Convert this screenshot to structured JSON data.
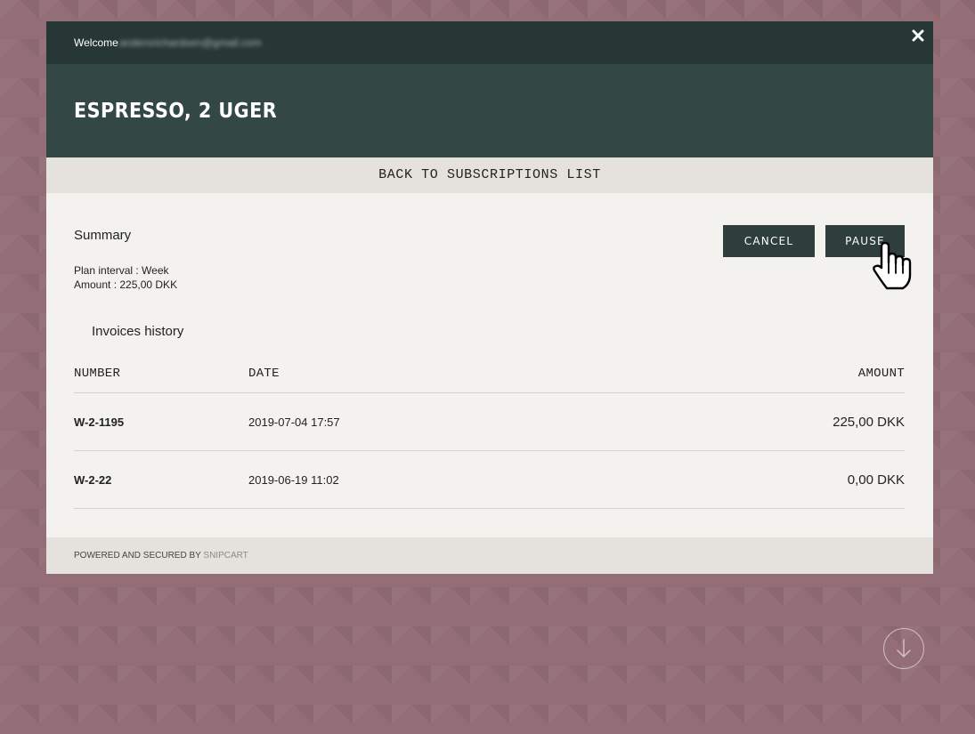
{
  "topbar": {
    "welcome_label": "Welcome",
    "user_email": "andersrichardsen@gmail.com"
  },
  "header": {
    "title": "ESPRESSO, 2 UGER"
  },
  "navigation": {
    "back_label": "BACK TO SUBSCRIPTIONS LIST"
  },
  "summary": {
    "heading": "Summary",
    "plan_interval": "Plan interval : Week",
    "amount": "Amount : 225,00 DKK"
  },
  "actions": {
    "cancel_label": "CANCEL",
    "pause_label": "PAUSE"
  },
  "invoices": {
    "heading": "Invoices history",
    "columns": [
      "NUMBER",
      "DATE",
      "AMOUNT"
    ],
    "rows": [
      {
        "number": "W-2-1195",
        "date": "2019-07-04 17:57",
        "amount": "225,00 DKK"
      },
      {
        "number": "W-2-22",
        "date": "2019-06-19 11:02",
        "amount": "0,00 DKK"
      }
    ]
  },
  "footer": {
    "text": "POWERED AND SECURED BY ",
    "link": "SNIPCART"
  },
  "icons": {
    "close": "close-icon",
    "cursor": "hand-pointer-icon",
    "scroll": "arrow-down-icon"
  },
  "colors": {
    "background": "#936e76",
    "topbar": "#273735",
    "titlebar": "#334745",
    "button": "#2d3e3c",
    "panel": "#f3f2ee",
    "bar": "#e5e2dd"
  }
}
